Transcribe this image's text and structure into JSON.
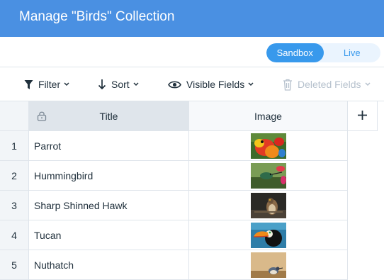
{
  "header": {
    "title": "Manage \"Birds\" Collection"
  },
  "mode": {
    "sandbox_label": "Sandbox",
    "live_label": "Live",
    "active": "Sandbox"
  },
  "toolbar": {
    "filter_label": "Filter",
    "sort_label": "Sort",
    "visible_fields_label": "Visible Fields",
    "deleted_fields_label": "Deleted Fields"
  },
  "table": {
    "columns": [
      "Title",
      "Image"
    ],
    "rows": [
      {
        "num": "1",
        "title": "Parrot",
        "image": "parrot-photo"
      },
      {
        "num": "2",
        "title": "Hummingbird",
        "image": "hummingbird-photo"
      },
      {
        "num": "3",
        "title": "Sharp Shinned Hawk",
        "image": "hawk-photo"
      },
      {
        "num": "4",
        "title": "Tucan",
        "image": "toucan-photo"
      },
      {
        "num": "5",
        "title": "Nuthatch",
        "image": "nuthatch-photo"
      }
    ]
  },
  "colors": {
    "header_bg": "#4a90e2",
    "accent": "#3899ec"
  }
}
